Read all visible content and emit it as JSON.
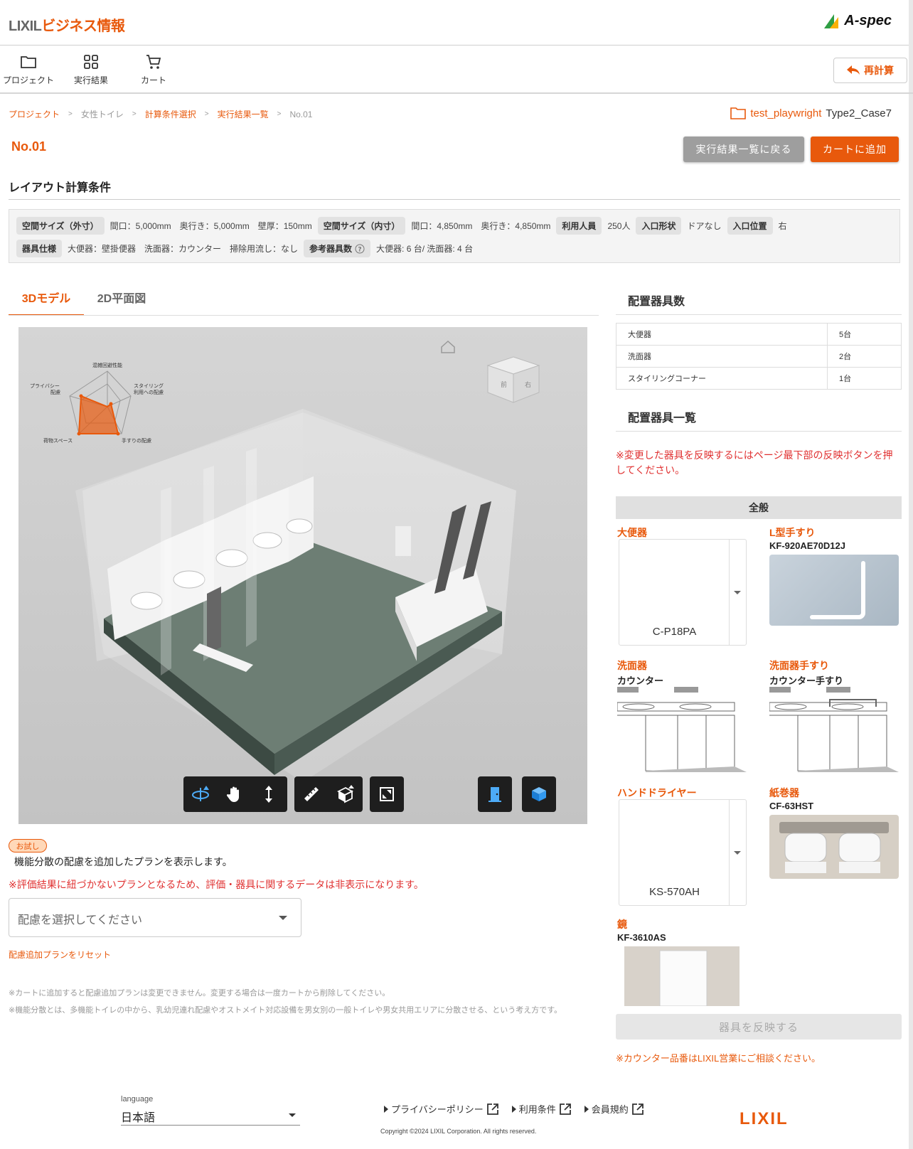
{
  "header": {
    "logo_prefix": "LIXIL",
    "logo_suffix": "ビジネス情報",
    "brand": "A-spec"
  },
  "toolbar": {
    "project": "プロジェクト",
    "results": "実行結果",
    "cart": "カート",
    "recalc": "再計算"
  },
  "breadcrumb": [
    "プロジェクト",
    "女性トイレ",
    "計算条件選択",
    "実行結果一覧",
    "No.01"
  ],
  "project_tag": {
    "name": "test_playwright",
    "case": "Type2_Case7"
  },
  "page": {
    "title": "No.01",
    "back": "実行結果一覧に戻る",
    "add_cart": "カートに追加"
  },
  "conditions": {
    "title": "レイアウト計算条件",
    "outer_label": "空間サイズ（外寸）",
    "outer_value": "間口：5,000mm　奥行き：5,000mm　壁厚：150mm",
    "inner_label": "空間サイズ（内寸）",
    "inner_value": "間口：4,850mm　奥行き：4,850mm",
    "users_label": "利用人員",
    "users_value": "250人",
    "entry_shape_label": "入口形状",
    "entry_shape_value": "ドアなし",
    "entry_pos_label": "入口位置",
    "entry_pos_value": "右",
    "fixture_label": "器具仕様",
    "fixture_value": "大便器：壁掛便器　洗面器：カウンター　掃除用流し：なし",
    "ref_label": "参考器具数",
    "ref_value": "大便器: 6 台/ 洗面器: 4 台"
  },
  "tabs": {
    "model3d": "3Dモデル",
    "plan2d": "2D平面図"
  },
  "radar": {
    "axes": [
      "混雑回避性能",
      "スタイリング\n利用への配慮",
      "手すりの配慮",
      "荷物スペース",
      "プライバシー\n配慮"
    ]
  },
  "trial": {
    "badge": "お試し",
    "desc": "機能分散の配慮を追加したプランを表示します。",
    "warn": "※評価結果に紐づかないプランとなるため、評価・器具に関するデータは非表示になります。",
    "placeholder": "配慮を選択してください",
    "reset": "配慮追加プランをリセット"
  },
  "notes": [
    "※カートに追加すると配慮追加プランは変更できません。変更する場合は一度カートから削除してください。",
    "※機能分散とは、多機能トイレの中から、乳幼児連れ配慮やオストメイト対応設備を男女別の一般トイレや男女共用エリアに分散させる、という考え方です。"
  ],
  "count": {
    "title": "配置器具数",
    "rows": [
      {
        "name": "大便器",
        "value": "5台"
      },
      {
        "name": "洗面器",
        "value": "2台"
      },
      {
        "name": "スタイリングコーナー",
        "value": "1台"
      }
    ]
  },
  "fixtures": {
    "title": "配置器具一覧",
    "reflect_note": "※変更した器具を反映するにはページ最下部の反映ボタンを押してください。",
    "general": "全般",
    "toilet": {
      "cat": "大便器",
      "value": "C-P18PA"
    },
    "lgrab": {
      "cat": "L型手すり",
      "name": "KF-920AE70D12J"
    },
    "basin": {
      "cat": "洗面器",
      "name": "カウンター"
    },
    "basin_grab": {
      "cat": "洗面器手すり",
      "name": "カウンター手すり"
    },
    "dryer": {
      "cat": "ハンドドライヤー",
      "value": "KS-570AH"
    },
    "paper": {
      "cat": "紙巻器",
      "name": "CF-63HST"
    },
    "mirror": {
      "cat": "鏡",
      "name": "KF-3610AS"
    },
    "apply": "器具を反映する",
    "counter_note": "※カウンター品番はLIXIL営業にご相談ください。"
  },
  "footer": {
    "lang_label": "language",
    "lang_value": "日本語",
    "privacy": "プライバシーポリシー",
    "terms": "利用条件",
    "membership": "会員規約",
    "copyright": "Copyright ©2024 LIXIL Corporation. All rights reserved.",
    "logo": "LIXIL"
  }
}
